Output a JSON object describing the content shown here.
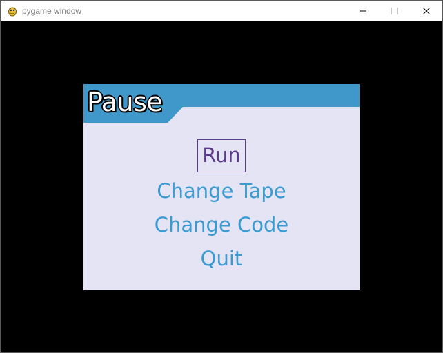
{
  "window": {
    "title": "pygame window"
  },
  "colors": {
    "header": "#3f98c9",
    "panel": "#e4e4f4",
    "menu_text": "#3a9ad2",
    "selected_text": "#5b3a8a"
  },
  "pause_menu": {
    "title": "Pause",
    "items": [
      {
        "label": "Run",
        "selected": true
      },
      {
        "label": "Change Tape",
        "selected": false
      },
      {
        "label": "Change Code",
        "selected": false
      },
      {
        "label": "Quit",
        "selected": false
      }
    ]
  }
}
